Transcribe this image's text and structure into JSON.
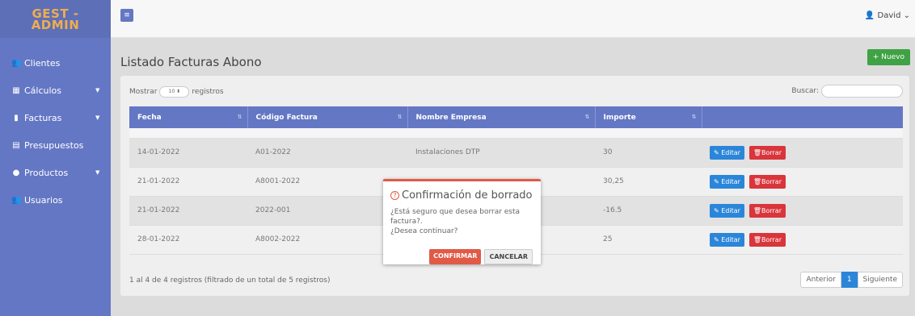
{
  "brand": {
    "line1": "GEST -",
    "line2": "ADMIN"
  },
  "sidebar": {
    "items": [
      {
        "label": "Clientes",
        "icon": "users-icon",
        "chevron": ""
      },
      {
        "label": "Cálculos",
        "icon": "calculator-icon",
        "chevron": "▼"
      },
      {
        "label": "Facturas",
        "icon": "file-icon",
        "chevron": "▼"
      },
      {
        "label": "Presupuestos",
        "icon": "file-text-icon",
        "chevron": ""
      },
      {
        "label": "Productos",
        "icon": "product-icon",
        "chevron": "▼"
      },
      {
        "label": "Usuarios",
        "icon": "user-group-icon",
        "chevron": ""
      }
    ]
  },
  "topbar": {
    "menu_icon": "≡",
    "user_name": "David"
  },
  "page": {
    "title": "Listado Facturas Abono",
    "new_button": "+ Nuevo"
  },
  "table_controls": {
    "show_prefix": "Mostrar",
    "page_size": "10 ⬍",
    "show_suffix": "registros",
    "search_label": "Buscar:"
  },
  "table": {
    "headers": [
      "Fecha",
      "Código Factura",
      "Nombre Empresa",
      "Importe",
      ""
    ],
    "rows": [
      {
        "fecha": "14-01-2022",
        "codigo": "A01-2022",
        "empresa": "Instalaciones DTP",
        "importe": "30"
      },
      {
        "fecha": "21-01-2022",
        "codigo": "A8001-2022",
        "empresa": "",
        "importe": "30,25"
      },
      {
        "fecha": "21-01-2022",
        "codigo": "2022-001",
        "empresa": "",
        "importe": "-16.5"
      },
      {
        "fecha": "28-01-2022",
        "codigo": "A8002-2022",
        "empresa": "",
        "importe": "25"
      }
    ],
    "edit_label": "Editar",
    "delete_label": "Borrar"
  },
  "footer": {
    "info": "1 al 4 de 4 registros (filtrado de un total de 5 registros)",
    "prev": "Anterior",
    "page": "1",
    "next": "Siguiente"
  },
  "modal": {
    "title": "Confirmación de borrado",
    "line1": "¿Está seguro que desea borrar esta factura?.",
    "line2": "¿Desea continuar?",
    "confirm": "CONFIRMAR",
    "cancel": "CANCELAR"
  },
  "colors": {
    "sidebar": "#6477c4",
    "brand_text": "#f0ad4e",
    "success": "#3fa244",
    "primary": "#2b86d9",
    "danger": "#d9353b",
    "modal_accent": "#e05a46"
  }
}
